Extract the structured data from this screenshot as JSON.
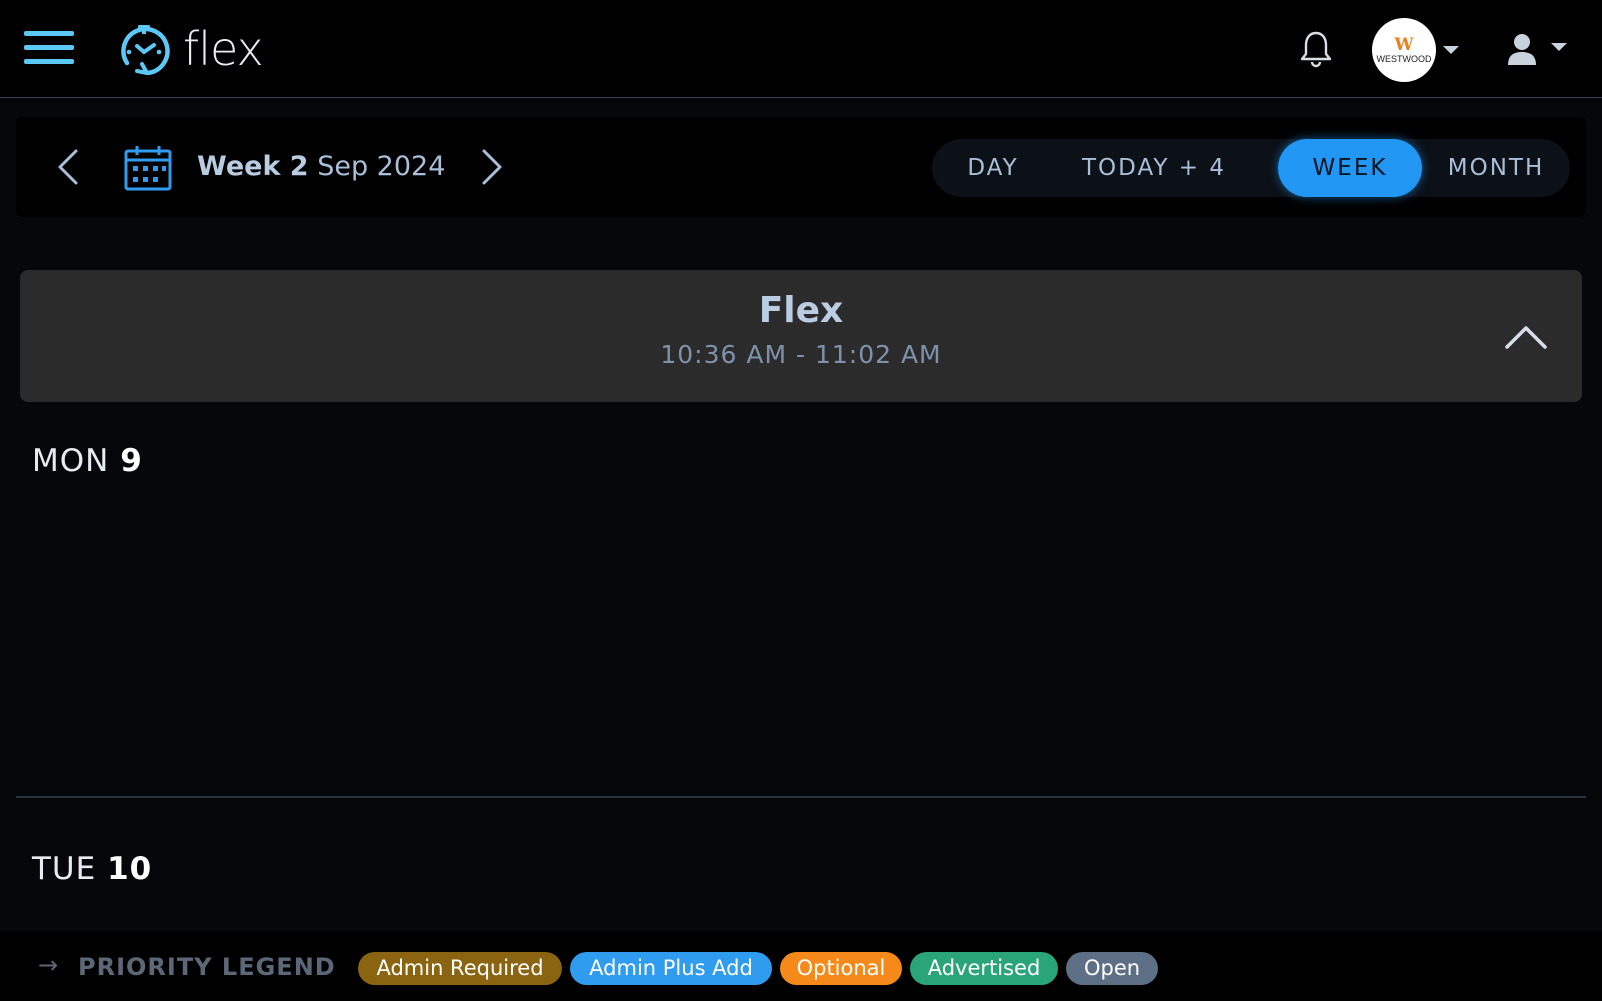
{
  "app": {
    "name": "flex"
  },
  "header": {
    "org": {
      "initial": "W",
      "name": "WESTWOOD"
    }
  },
  "week_nav": {
    "week_bold": "Week 2",
    "month_year": "Sep 2024",
    "views": [
      {
        "label": "DAY",
        "active": false
      },
      {
        "label": "TODAY + 4",
        "active": false
      },
      {
        "label": "WEEK",
        "active": true
      },
      {
        "label": "MONTH",
        "active": false
      }
    ]
  },
  "shift": {
    "title": "Flex",
    "time": "10:36 AM - 11:02 AM"
  },
  "days": [
    {
      "dow": "MON",
      "num": "9"
    },
    {
      "dow": "TUE",
      "num": "10"
    }
  ],
  "legend": {
    "title": "PRIORITY LEGEND",
    "items": [
      {
        "label": "Admin Required",
        "color": "#8a6410"
      },
      {
        "label": "Admin Plus Add",
        "color": "#2f9cf0"
      },
      {
        "label": "Optional",
        "color": "#f58a1a"
      },
      {
        "label": "Advertised",
        "color": "#2aa57a"
      },
      {
        "label": "Open",
        "color": "#5d6f85"
      }
    ]
  },
  "colors": {
    "accent": "#2196f3",
    "logo_blue": "#5cc8f5"
  }
}
